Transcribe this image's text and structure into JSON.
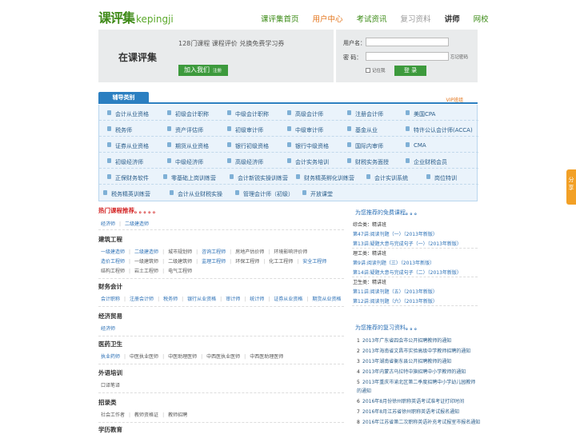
{
  "logo": {
    "cn": "课评集",
    "en": "kepingji"
  },
  "nav": [
    "课评集首页",
    "用户中心",
    "考试资讯",
    "复习资料",
    "讲师",
    "网校"
  ],
  "promo": {
    "tagline": "在课评集",
    "line": "128门课程  课程评价  兑换免费学习券",
    "join": "加入我们",
    "join_sub": "注册"
  },
  "login": {
    "user_label": "用户名：",
    "pw_label": "密  码：",
    "forgot": "忘记密码",
    "remember": "记住我",
    "button": "登  录"
  },
  "categories": {
    "tab": "辅导类别",
    "vip": "VIP班组",
    "rows": [
      [
        "会计从业资格",
        "初级会计职称",
        "中级会计职称",
        "高级会计师",
        "注册会计师",
        "美国CPA"
      ],
      [
        "税务师",
        "资产评估师",
        "初级审计师",
        "中级审计师",
        "基金从业",
        "特许公认会计师(ACCA)"
      ],
      [
        "证券从业资格",
        "期货从业资格",
        "银行初级资格",
        "银行中级资格",
        "国际内审师",
        "CMA"
      ],
      [
        "初级经济师",
        "中级经济师",
        "高级经济师",
        "会计实务培训",
        "财税实务面授",
        "企业财税会员"
      ],
      [
        "正保财务软件",
        "零基础上岗训练营",
        "会计新锐实操训练营",
        "财务精英孵化训练营",
        "会计实训系统",
        "岗位特训"
      ],
      [
        "税务精英训练营",
        "会计从业财税实操",
        "管理会计师（初级）",
        "开放课堂"
      ]
    ]
  },
  "left": {
    "hot_title": "热门课程推荐",
    "hot_dots": "。。。。。",
    "hot_links": [
      "经济师",
      "二级建造师"
    ],
    "sections": [
      {
        "title": "建筑工程",
        "rows": [
          [
            "一级建造师",
            "二级建造师",
            "城市规划师",
            "咨询工程师",
            "房地产估价师",
            "环境影响评价师"
          ],
          [
            "造价工程师",
            "一级建筑师",
            "二级建筑师",
            "监理工程师",
            "环保工程师",
            "化工工程师",
            "安全工程师"
          ],
          [
            "结构工程师",
            "岩土工程师",
            "电气工程师"
          ]
        ]
      },
      {
        "title": "财务会计",
        "rows": [
          [
            "会计职称",
            "注册会计师",
            "税务师",
            "银行从业资格",
            "审计师",
            "统计师",
            "证券从业资格",
            "期货从业资格"
          ]
        ]
      },
      {
        "title": "经济贸易",
        "rows": [
          [
            "经济师"
          ]
        ]
      },
      {
        "title": "医药卫生",
        "rows": [
          [
            "执业药师",
            "中医执业医师",
            "中医助理医师",
            "中西医执业医师",
            "中西医助理医师"
          ]
        ]
      },
      {
        "title": "外语培训",
        "rows": [
          [
            "口译笔译"
          ]
        ]
      },
      {
        "title": "招录类",
        "rows": [
          [
            "社会工作者",
            "教师资格证",
            "教师招聘"
          ]
        ]
      },
      {
        "title": "学历教育",
        "rows": []
      }
    ]
  },
  "right": {
    "free_title": "为您推荐的免费课程",
    "free_dots": "。。。",
    "groups": [
      {
        "sub": "综合类：精讲班",
        "links": [
          "第47讲:阅读刊题（一）（2013年新版）",
          "第13讲:疑题大意与完成句子（一）（2013年新版）"
        ]
      },
      {
        "sub": "理工类：精讲班",
        "links": [
          "第9讲:阅读刊题（三）（2013年新版）",
          "第14讲:疑题大意与完成句子（二）（2013年新版）"
        ]
      },
      {
        "sub": "卫生类：精讲班",
        "links": [
          "第11讲:阅读刊题（五）（2013年新版）",
          "第12讲:阅读刊题（六）（2013年新版）"
        ]
      }
    ],
    "review_title": "为您推荐的复习资料",
    "review_dots": "。。。",
    "review": [
      "2013年广东省四会市公开招聘教师的通知",
      "2013年海南省文昌市实验高级中学教师招聘的通知",
      "2013年湖南省衡东县公开招聘教师的通知",
      "2013年内蒙古乌拉特中旗招聘中小学教师的通知",
      "2013年重庆市渝北区第二季度招聘中小学幼儿园教师的通知",
      "2016年8月份徐州职称英语考试准考证打印时间",
      "2016年8月江苏省徐州职称英语考试报名通知",
      "2016年江苏省第二次职称英语补充考试报室市报名通知"
    ]
  },
  "share": "分享"
}
